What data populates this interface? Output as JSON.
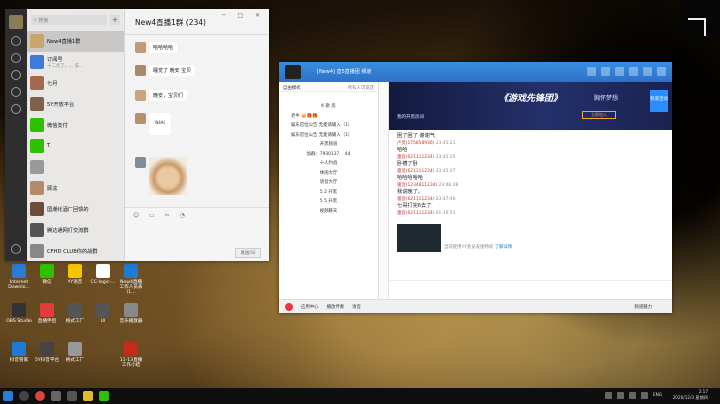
{
  "desktop_icons": [
    {
      "label": "Internet Downlo...",
      "color": "#2a7bd4"
    },
    {
      "label": "微信",
      "color": "#2dc100"
    },
    {
      "label": "YY语音",
      "color": "#f5c400"
    },
    {
      "label": "CC-logic-...",
      "color": "#ffffff"
    },
    {
      "label": "Now4直播工作人员表 (1...",
      "color": "#1d7bd4"
    },
    {
      "label": "OBS Studio",
      "color": "#333333"
    },
    {
      "label": "直播伴侣",
      "color": "#e23b3b"
    },
    {
      "label": "格式工厂",
      "color": "#555555"
    },
    {
      "label": "UI",
      "color": "#555555"
    },
    {
      "label": "音乐播放器",
      "color": "#888888"
    },
    {
      "label": "抖音管家",
      "color": "#1d7bd4"
    },
    {
      "label": "5Y抖音平台",
      "color": "#444444"
    },
    {
      "label": "格式工厂",
      "color": "#999999"
    },
    {
      "label": "11-13直播工作小结",
      "color": "#c42b1c"
    }
  ],
  "wechat": {
    "search_placeholder": "搜索",
    "plus": "+",
    "chats": [
      {
        "name": "New4直播1群",
        "preview": "",
        "time": "",
        "color": "#c9a66b"
      },
      {
        "name": "订阅号",
        "preview": "十二点了，... 该...",
        "time": "",
        "color": "#3d7bd8"
      },
      {
        "name": "七月",
        "preview": "",
        "time": "",
        "color": "#a36a4f"
      },
      {
        "name": "5Y开放平台",
        "preview": "",
        "time": "",
        "color": "#7d6248"
      },
      {
        "name": "微信支付",
        "preview": "",
        "time": "",
        "color": "#2dc100"
      },
      {
        "name": "T",
        "preview": "",
        "time": "",
        "color": "#2dc100"
      },
      {
        "name": "",
        "preview": "",
        "time": "",
        "color": "#999999"
      },
      {
        "name": "顾泫",
        "preview": "",
        "time": "",
        "color": "#b58b6a"
      },
      {
        "name": "国潮化酒厂回馈的",
        "preview": "",
        "time": "",
        "color": "#6c4d3a"
      },
      {
        "name": "腾达通网打交流群",
        "preview": "",
        "time": "",
        "color": "#555555"
      },
      {
        "name": "CFHD CLUB你的战群",
        "preview": "",
        "time": "",
        "color": "#888888"
      }
    ],
    "title": "New4直播1群 (234)",
    "window_buttons": "─ □ ✕",
    "messages": [
      {
        "text": "哈哈哈哈",
        "avatar": "#c09a7a"
      },
      {
        "text": "睡觉了 晚安 宝贝",
        "avatar": "#a98c66"
      },
      {
        "text": "晚安，宝贝们",
        "avatar": "#c7a480"
      }
    ],
    "sticker_text": "N4AI",
    "tools": "☺ ▭ ✂ ◔",
    "send_label": "发送(S)"
  },
  "yy": {
    "title": "[New4] 直5直播团 频道",
    "channel_mode": "自由模式",
    "channel_right": "所有人可说话",
    "channel_rows": [
      "K 歌 房",
      "老牛 👑🎁🎁",
      "娱乐官位公告 无麦请输入（1）",
      "娱乐官位公告 无麦请输入（1）",
      "开黑频道",
      "加群：7930137ﾠ 44",
      "十人约战",
      "休闲大厅",
      "语音大厅",
      "5 2 开黑",
      "5 5 开黑",
      "视频聊天"
    ],
    "banner_title": "《游戏先锋团》",
    "banner_sub": "胸怀梦想",
    "banner_channel": "我的开黑房间",
    "banner_button": "立即加入",
    "banner_box": "频道活动",
    "chat_lines": [
      {
        "type": "text",
        "text": "困了困了 谢谢气"
      },
      {
        "type": "meta",
        "name": "卢灵(175858936)",
        "time": "23:45:21"
      },
      {
        "type": "text",
        "text": "哈哈"
      },
      {
        "type": "meta",
        "name": "骚音(621111234)",
        "time": "23:45:25"
      },
      {
        "type": "text",
        "text": "卧槽了卧"
      },
      {
        "type": "meta",
        "name": "骚音(621111234)",
        "time": "23:45:27"
      },
      {
        "type": "text",
        "text": "哈哈哈哈哈"
      },
      {
        "type": "meta",
        "name": "骚音(1234811234)",
        "time": "23:46:28"
      },
      {
        "type": "text",
        "text": "我说晚了。"
      },
      {
        "type": "meta",
        "name": "骚音(621111234)",
        "time": "23:47:46"
      },
      {
        "type": "text",
        "text": "七哥打完6去了"
      },
      {
        "type": "meta",
        "name": "骚音(621111234)",
        "time": "01:16:51"
      }
    ],
    "video_caption": "当前使用YY会员发图特权",
    "video_link": "了解详情",
    "bottom_items": [
      "应用中心",
      "播放伴奏",
      "语音"
    ],
    "bottom_right": "频道魅力"
  },
  "taskbar": {
    "time": "2:17",
    "date": "2020/12/3 星期四",
    "lang": "ENG"
  }
}
